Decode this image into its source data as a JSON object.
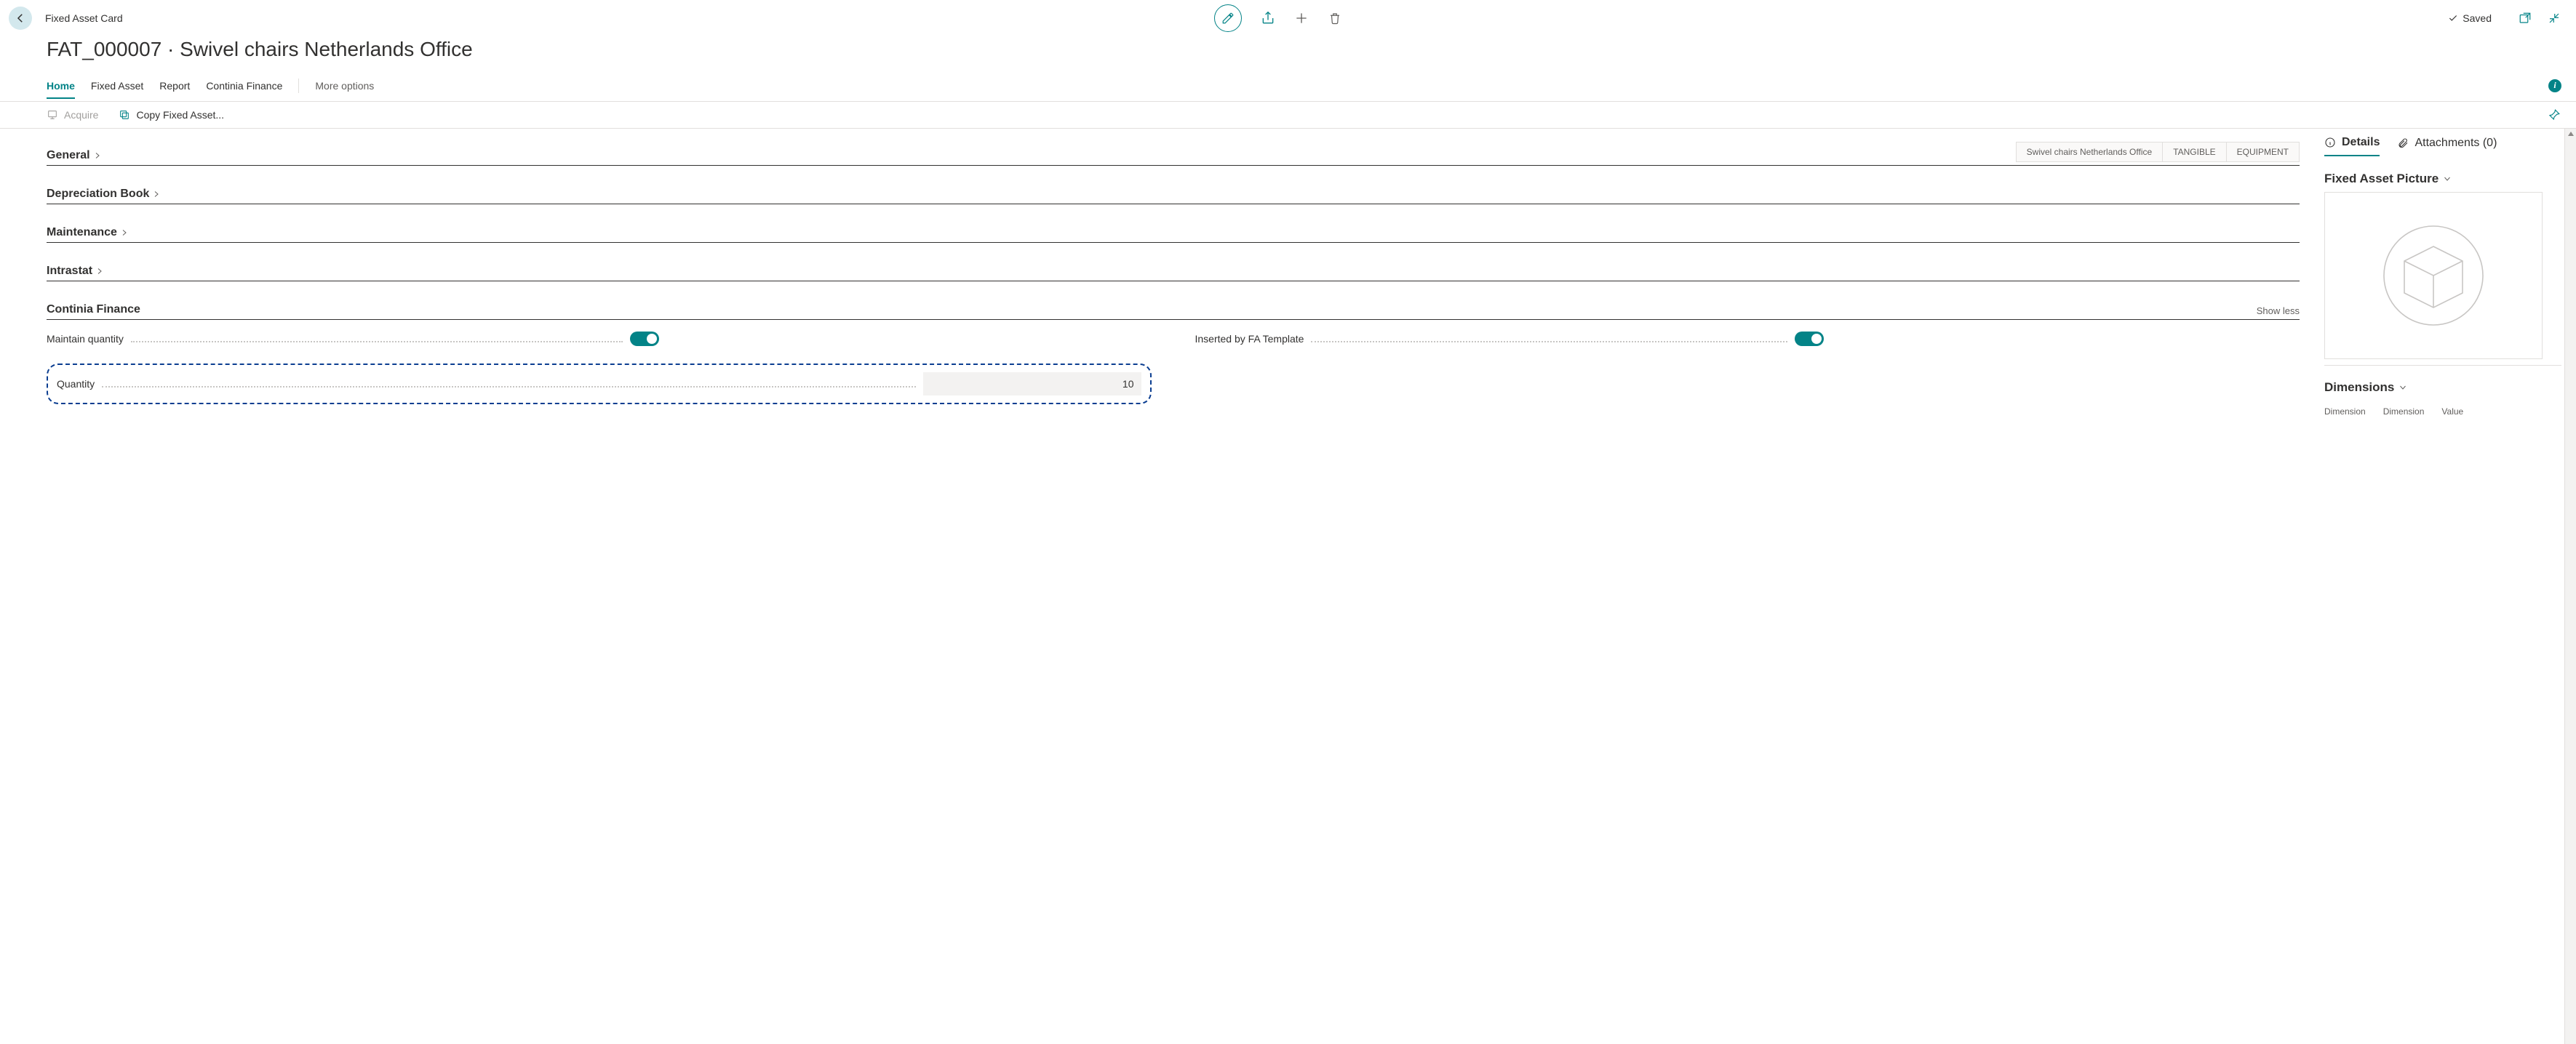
{
  "header": {
    "card_type": "Fixed Asset Card",
    "title": "FAT_000007 · Swivel chairs Netherlands Office",
    "saved_label": "Saved"
  },
  "tabs": {
    "home": "Home",
    "fixed_asset": "Fixed Asset",
    "report": "Report",
    "continia": "Continia Finance",
    "more": "More options"
  },
  "secondary": {
    "acquire": "Acquire",
    "copy": "Copy Fixed Asset..."
  },
  "fasttabs": {
    "general": {
      "title": "General",
      "summary": [
        "Swivel chairs Netherlands Office",
        "TANGIBLE",
        "EQUIPMENT"
      ]
    },
    "depreciation": {
      "title": "Depreciation Book"
    },
    "maintenance": {
      "title": "Maintenance"
    },
    "intrastat": {
      "title": "Intrastat"
    },
    "continia": {
      "title": "Continia Finance",
      "show_less": "Show less",
      "maintain_qty_label": "Maintain quantity",
      "maintain_qty_on": true,
      "quantity_label": "Quantity",
      "quantity_value": "10",
      "inserted_label": "Inserted by FA Template",
      "inserted_on": true
    }
  },
  "factbox": {
    "details_label": "Details",
    "attachments_label": "Attachments (0)",
    "picture_title": "Fixed Asset Picture",
    "dimensions_title": "Dimensions",
    "dim_cols": [
      "Dimension",
      "Dimension",
      "Value"
    ]
  }
}
